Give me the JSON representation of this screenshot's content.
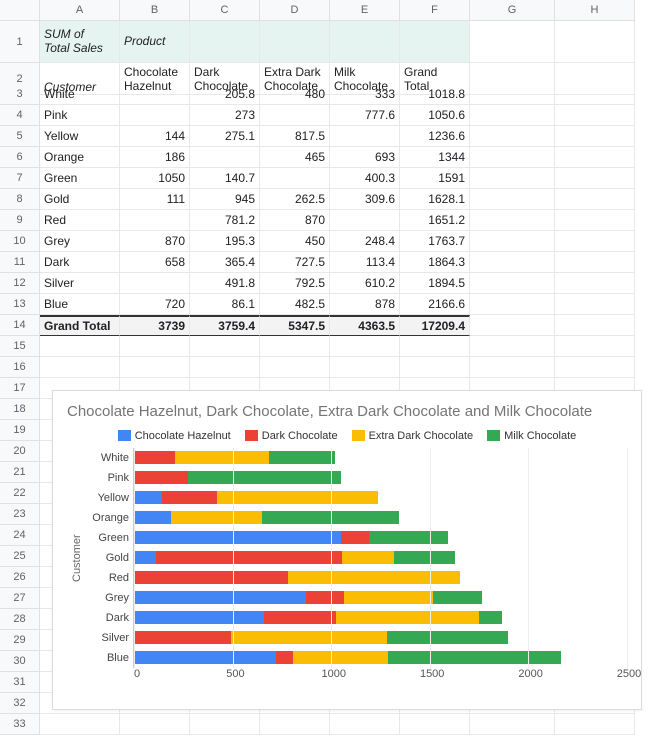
{
  "columns": [
    "A",
    "B",
    "C",
    "D",
    "E",
    "F",
    "G",
    "H"
  ],
  "row_numbers": [
    1,
    2,
    3,
    4,
    5,
    6,
    7,
    8,
    9,
    10,
    11,
    12,
    13,
    14,
    15,
    16,
    17,
    18,
    19,
    20,
    21,
    22,
    23,
    24,
    25,
    26,
    27,
    28,
    29,
    30,
    31,
    32,
    33
  ],
  "header": {
    "sum_label": "SUM of Total Sales",
    "product_label": "Product",
    "customer_label": "Customer",
    "products": [
      "Chocolate Hazelnut",
      "Dark Chocolate",
      "Extra Dark Chocolate",
      "Milk Chocolate",
      "Grand Total"
    ]
  },
  "rows": [
    {
      "customer": "White",
      "vals": [
        "",
        "205.8",
        "480",
        "333",
        "1018.8"
      ]
    },
    {
      "customer": "Pink",
      "vals": [
        "",
        "273",
        "",
        "777.6",
        "1050.6"
      ]
    },
    {
      "customer": "Yellow",
      "vals": [
        "144",
        "275.1",
        "817.5",
        "",
        "1236.6"
      ]
    },
    {
      "customer": "Orange",
      "vals": [
        "186",
        "",
        "465",
        "693",
        "1344"
      ]
    },
    {
      "customer": "Green",
      "vals": [
        "1050",
        "140.7",
        "",
        "400.3",
        "1591"
      ]
    },
    {
      "customer": "Gold",
      "vals": [
        "111",
        "945",
        "262.5",
        "309.6",
        "1628.1"
      ]
    },
    {
      "customer": "Red",
      "vals": [
        "",
        "781.2",
        "870",
        "",
        "1651.2"
      ]
    },
    {
      "customer": "Grey",
      "vals": [
        "870",
        "195.3",
        "450",
        "248.4",
        "1763.7"
      ]
    },
    {
      "customer": "Dark",
      "vals": [
        "658",
        "365.4",
        "727.5",
        "113.4",
        "1864.3"
      ]
    },
    {
      "customer": "Silver",
      "vals": [
        "",
        "491.8",
        "792.5",
        "610.2",
        "1894.5"
      ]
    },
    {
      "customer": "Blue",
      "vals": [
        "720",
        "86.1",
        "482.5",
        "878",
        "2166.6"
      ]
    }
  ],
  "grand_total": {
    "label": "Grand Total",
    "vals": [
      "3739",
      "3759.4",
      "5347.5",
      "4363.5",
      "17209.4"
    ]
  },
  "chart_data": {
    "type": "bar",
    "orientation": "horizontal",
    "stacked": true,
    "title": "Chocolate Hazelnut, Dark Chocolate, Extra Dark Chocolate and Milk Chocolate",
    "ylabel": "Customer",
    "xlabel": "",
    "xlim": [
      0,
      2500
    ],
    "xticks": [
      0,
      500,
      1000,
      1500,
      2000,
      2500
    ],
    "categories": [
      "White",
      "Pink",
      "Yellow",
      "Orange",
      "Green",
      "Gold",
      "Red",
      "Grey",
      "Dark",
      "Silver",
      "Blue"
    ],
    "series": [
      {
        "name": "Chocolate Hazelnut",
        "color": "#4285F4",
        "values": [
          0,
          0,
          144,
          186,
          1050,
          111,
          0,
          870,
          658,
          0,
          720
        ]
      },
      {
        "name": "Dark Chocolate",
        "color": "#EA4335",
        "values": [
          205.8,
          273,
          275.1,
          0,
          140.7,
          945,
          781.2,
          195.3,
          365.4,
          491.8,
          86.1
        ]
      },
      {
        "name": "Extra Dark Chocolate",
        "color": "#FBBC04",
        "values": [
          480,
          0,
          817.5,
          465,
          0,
          262.5,
          870,
          450,
          727.5,
          792.5,
          482.5
        ]
      },
      {
        "name": "Milk Chocolate",
        "color": "#34A853",
        "values": [
          333,
          777.6,
          0,
          693,
          400.3,
          309.6,
          0,
          248.4,
          113.4,
          610.2,
          878
        ]
      }
    ]
  }
}
